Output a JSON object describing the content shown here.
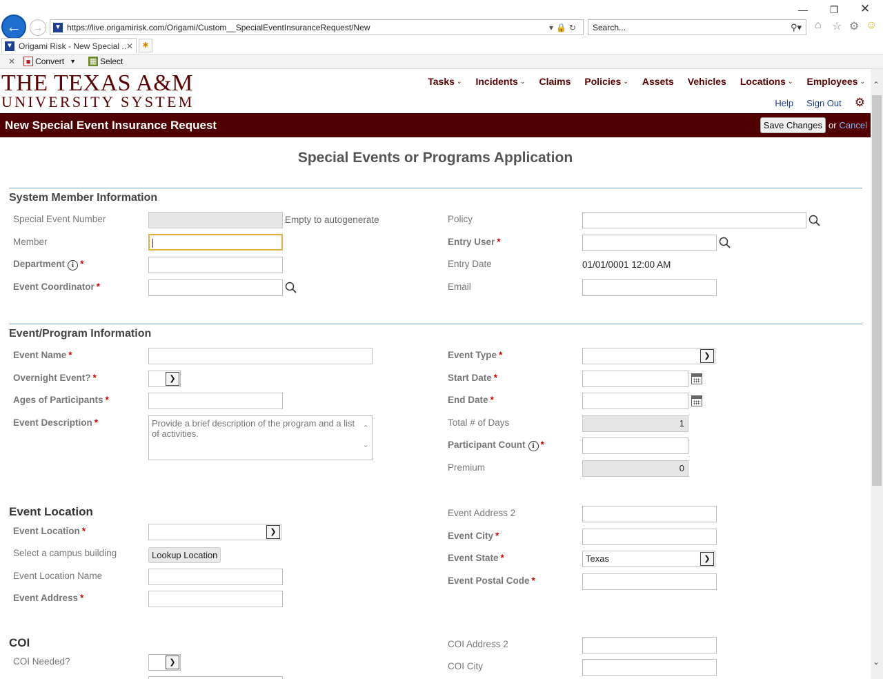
{
  "browser": {
    "url": "https://live.origamirisk.com/Origami/Custom__SpecialEventInsuranceRequest/New",
    "search_placeholder": "Search...",
    "tab_title": "Origami Risk - New Special ...",
    "cmd_convert": "Convert",
    "cmd_select": "Select"
  },
  "logo": {
    "line1": "THE TEXAS A&M",
    "line2": "UNIVERSITY SYSTEM"
  },
  "nav": {
    "items": [
      "Tasks",
      "Incidents",
      "Claims",
      "Policies",
      "Assets",
      "Vehicles",
      "Locations",
      "Employees"
    ],
    "help": "Help",
    "sign_out": "Sign Out"
  },
  "titlebar": {
    "title": "New Special Event Insurance Request",
    "save": "Save Changes",
    "or": "or",
    "cancel": "Cancel"
  },
  "form_title": "Special Events or Programs Application",
  "system_member": {
    "heading": "System Member Information",
    "special_event_number": "Special Event Number",
    "autogen_hint": "Empty to autogenerate",
    "member": "Member",
    "department": "Department",
    "event_coordinator": "Event Coordinator",
    "policy": "Policy",
    "entry_user": "Entry User",
    "entry_date": "Entry Date",
    "entry_date_value": "01/01/0001 12:00 AM",
    "email": "Email"
  },
  "event_program": {
    "heading": "Event/Program Information",
    "event_name": "Event Name",
    "overnight": "Overnight Event?",
    "ages": "Ages of Participants",
    "description": "Event Description",
    "description_placeholder": "Provide a brief description of the program and a list of activities.",
    "event_type": "Event Type",
    "start_date": "Start Date",
    "end_date": "End Date",
    "total_days": "Total # of Days",
    "total_days_value": "1",
    "participant_count": "Participant Count",
    "premium": "Premium",
    "premium_value": "0"
  },
  "event_location": {
    "heading": "Event Location",
    "event_location": "Event Location",
    "campus_building": "Select a campus building",
    "lookup": "Lookup Location",
    "location_name": "Event Location Name",
    "address": "Event Address",
    "address2": "Event Address 2",
    "city": "Event City",
    "state": "Event State",
    "state_value": "Texas",
    "postal": "Event Postal Code"
  },
  "coi": {
    "heading": "COI",
    "needed": "COI Needed?",
    "address2": "COI Address 2",
    "city": "COI City"
  },
  "colors": {
    "maroon": "#500000",
    "link": "#1b3a8f",
    "rule": "#6fa1c9"
  }
}
